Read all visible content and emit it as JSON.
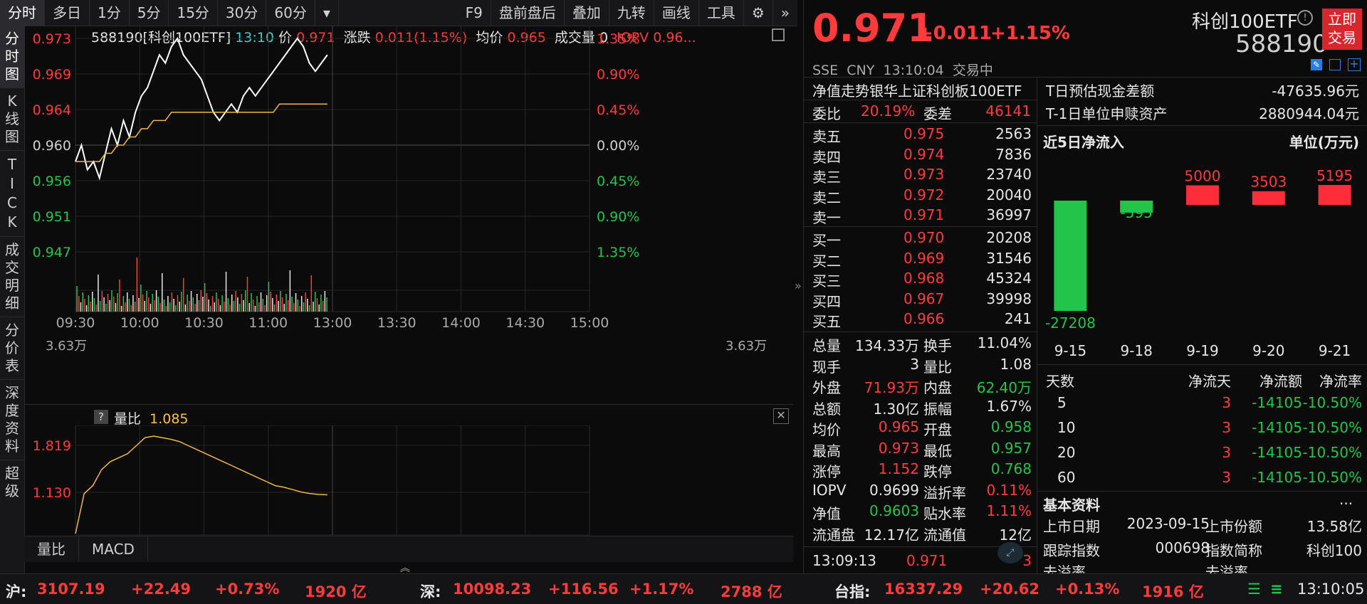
{
  "toolbar": {
    "items": [
      "分时",
      "多日",
      "1分",
      "5分",
      "15分",
      "30分",
      "60分",
      "F9",
      "盘前盘后",
      "叠加",
      "九转",
      "画线",
      "工具"
    ]
  },
  "vtabs": [
    "分时图",
    "K线图",
    "TICK",
    "成交明细",
    "分价表",
    "深度资料",
    "超级"
  ],
  "info": {
    "code_name": "588190[科创100ETF]",
    "time": "13:10",
    "price_label": "价",
    "price": "0.971",
    "change_label": "涨跌",
    "change": "0.011(1.15%)",
    "avg_label": "均价",
    "avg": "0.965",
    "vol_label": "成交量",
    "vol": "0",
    "iopv_label": "IOPV",
    "iopv": "0.96..."
  },
  "chart_data": [
    {
      "type": "line",
      "y_left_ticks": [
        "0.973",
        "0.969",
        "0.964",
        "0.960",
        "0.956",
        "0.951",
        "0.947"
      ],
      "y_right_ticks": [
        "1.35%",
        "0.90%",
        "0.45%",
        "0.00%",
        "0.45%",
        "0.90%",
        "1.35%"
      ],
      "x_ticks": [
        "09:30",
        "10:00",
        "10:30",
        "11:00",
        "13:00",
        "13:30",
        "14:00",
        "14:30",
        "15:00"
      ],
      "ylim": [
        0.947,
        0.973
      ],
      "prev_close": 0.96,
      "vol_label": "3.63万",
      "series": [
        {
          "values": [
            0.958,
            0.96,
            0.957,
            0.958,
            0.956,
            0.959,
            0.962,
            0.96,
            0.963,
            0.961,
            0.964,
            0.966,
            0.967,
            0.969,
            0.971,
            0.97,
            0.972,
            0.973,
            0.971,
            0.97,
            0.969,
            0.968,
            0.966,
            0.964,
            0.963,
            0.964,
            0.965,
            0.964,
            0.966,
            0.967,
            0.966,
            0.967,
            0.968,
            0.969,
            0.97,
            0.971,
            0.972,
            0.973,
            0.972,
            0.97,
            0.969,
            0.97,
            0.971
          ]
        },
        {
          "values": [
            0.958,
            0.958,
            0.958,
            0.958,
            0.958,
            0.959,
            0.959,
            0.96,
            0.96,
            0.961,
            0.961,
            0.962,
            0.962,
            0.963,
            0.963,
            0.963,
            0.964,
            0.964,
            0.964,
            0.964,
            0.964,
            0.964,
            0.964,
            0.964,
            0.964,
            0.964,
            0.964,
            0.964,
            0.964,
            0.964,
            0.964,
            0.964,
            0.964,
            0.964,
            0.965,
            0.965,
            0.965,
            0.965,
            0.965,
            0.965,
            0.965,
            0.965,
            0.965
          ]
        }
      ]
    },
    {
      "type": "line",
      "title": "量比",
      "value": "1.085",
      "y_ticks": [
        "1.819",
        "1.130"
      ],
      "ylim": [
        0.6,
        1.9
      ],
      "values": [
        0.6,
        1.1,
        1.2,
        1.4,
        1.5,
        1.55,
        1.6,
        1.7,
        1.8,
        1.82,
        1.8,
        1.78,
        1.75,
        1.7,
        1.65,
        1.6,
        1.55,
        1.5,
        1.45,
        1.4,
        1.35,
        1.3,
        1.25,
        1.2,
        1.18,
        1.15,
        1.12,
        1.1,
        1.09,
        1.085
      ]
    }
  ],
  "subtabs": [
    "量比",
    "MACD"
  ],
  "quote": {
    "price": "0.971",
    "change": "+0.011",
    "pct": "+1.15%",
    "exchange": "SSE",
    "currency": "CNY",
    "time": "13:10:04",
    "state": "交易中",
    "name": "科创100ETF",
    "code": "588190",
    "trade_button": "立即交易"
  },
  "nav": {
    "title": "净值走势",
    "index_name": "银华上证科创板100ETF"
  },
  "weibi": {
    "label1": "委比",
    "val1": "20.19%",
    "label2": "委差",
    "val2": "46141"
  },
  "asks": [
    {
      "label": "卖五",
      "price": "0.975",
      "vol": "2563"
    },
    {
      "label": "卖四",
      "price": "0.974",
      "vol": "7836"
    },
    {
      "label": "卖三",
      "price": "0.973",
      "vol": "23740"
    },
    {
      "label": "卖二",
      "price": "0.972",
      "vol": "20040"
    },
    {
      "label": "卖一",
      "price": "0.971",
      "vol": "36997"
    }
  ],
  "bids": [
    {
      "label": "买一",
      "price": "0.970",
      "vol": "20208"
    },
    {
      "label": "买二",
      "price": "0.969",
      "vol": "31546"
    },
    {
      "label": "买三",
      "price": "0.968",
      "vol": "45324"
    },
    {
      "label": "买四",
      "price": "0.967",
      "vol": "39998"
    },
    {
      "label": "买五",
      "price": "0.966",
      "vol": "241"
    }
  ],
  "stats": [
    {
      "l1": "总量",
      "v1": "134.33万",
      "c1": "white",
      "l2": "换手",
      "v2": "11.04%",
      "c2": "white"
    },
    {
      "l1": "现手",
      "v1": "3",
      "c1": "white",
      "l2": "量比",
      "v2": "1.08",
      "c2": "white"
    },
    {
      "l1": "外盘",
      "v1": "71.93万",
      "c1": "red",
      "l2": "内盘",
      "v2": "62.40万",
      "c2": "green"
    },
    {
      "l1": "总额",
      "v1": "1.30亿",
      "c1": "white",
      "l2": "振幅",
      "v2": "1.67%",
      "c2": "white"
    },
    {
      "l1": "均价",
      "v1": "0.965",
      "c1": "red",
      "l2": "开盘",
      "v2": "0.958",
      "c2": "green"
    },
    {
      "l1": "最高",
      "v1": "0.973",
      "c1": "red",
      "l2": "最低",
      "v2": "0.957",
      "c2": "green"
    },
    {
      "l1": "涨停",
      "v1": "1.152",
      "c1": "red",
      "l2": "跌停",
      "v2": "0.768",
      "c2": "green"
    },
    {
      "l1": "IOPV",
      "v1": "0.9699",
      "c1": "white",
      "l2": "溢折率",
      "v2": "0.11%",
      "c2": "red"
    },
    {
      "l1": "净值",
      "v1": "0.9603",
      "c1": "green",
      "l2": "贴水率",
      "v2": "1.11%",
      "c2": "red"
    },
    {
      "l1": "流通盘",
      "v1": "12.17亿",
      "c1": "white",
      "l2": "流通值",
      "v2": "12亿",
      "c2": "white"
    }
  ],
  "last_tick": {
    "time": "13:09:13",
    "price": "0.971",
    "vol": "3"
  },
  "etf": {
    "cash_label": "T日预估现金差额",
    "cash_val": "-47635.96元",
    "nav_label": "T-1日单位申赎资产",
    "nav_val": "2880944.04元",
    "flow_title": "近5日净流入",
    "flow_unit": "单位(万元)"
  },
  "flow_chart": {
    "type": "bar",
    "categories": [
      "9-15",
      "9-18",
      "9-19",
      "9-20",
      "9-21"
    ],
    "values": [
      -27208,
      -595,
      5000,
      3503,
      5195
    ],
    "labels": [
      "-27208",
      "-595",
      "5000",
      "3503",
      "5195"
    ]
  },
  "flow_table": {
    "headers": [
      "天数",
      "净流天",
      "净流额",
      "净流率"
    ],
    "rows": [
      [
        "5",
        "3",
        "-14105",
        "-10.50%"
      ],
      [
        "10",
        "3",
        "-14105",
        "-10.50%"
      ],
      [
        "20",
        "3",
        "-14105",
        "-10.50%"
      ],
      [
        "60",
        "3",
        "-14105",
        "-10.50%"
      ]
    ]
  },
  "basic": {
    "title": "基本资料",
    "more": "...",
    "list_date_label": "上市日期",
    "list_date": "2023-09-15",
    "shares_label": "上市份额",
    "shares": "13.58亿",
    "track_label": "跟踪指数",
    "track": "000698",
    "abbr_label": "指数简称",
    "abbr": "科创100",
    "cut1": "去溢率",
    "cut2": "去溢率"
  },
  "status_bar": {
    "sh_label": "沪:",
    "sh_val": "3107.19",
    "sh_chg": "+22.49",
    "sh_pct": "+0.73%",
    "sh_amt": "1920 亿",
    "sz_label": "深:",
    "sz_val": "10098.23",
    "sz_chg": "+116.56",
    "sz_pct": "+1.17%",
    "sz_amt": "2788 亿",
    "tw_label": "台指:",
    "tw_val": "16337.29",
    "tw_chg": "+20.62",
    "tw_pct": "+0.13%",
    "tw_amt": "1916 亿",
    "clock": "13:10:05"
  }
}
